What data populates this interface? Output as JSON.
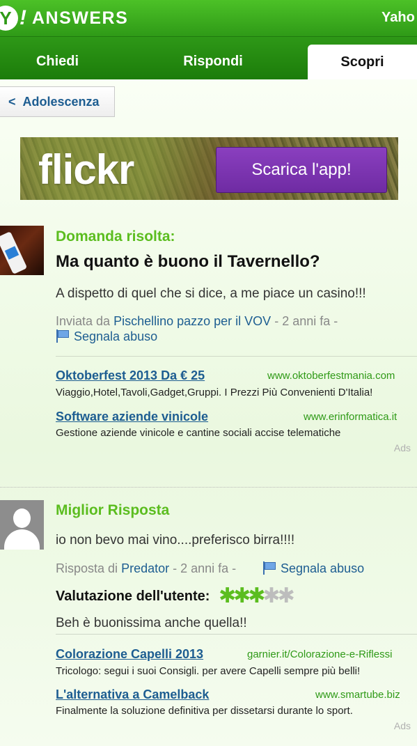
{
  "header": {
    "logo_mark": "Y",
    "logo_bang": "!",
    "logo_word": "ANSWERS",
    "yahoo_link": "Yaho"
  },
  "tabs": [
    {
      "label": "Chiedi",
      "active": false
    },
    {
      "label": "Rispondi",
      "active": false
    },
    {
      "label": "Scopri",
      "active": true
    }
  ],
  "breadcrumb": {
    "chevron": "<",
    "label": "Adolescenza"
  },
  "banner": {
    "brand": "flickr",
    "cta": "Scarica l'app!"
  },
  "question": {
    "status_label": "Domanda risolta:",
    "title": "Ma quanto è buono il Tavernello?",
    "details": "A dispetto di quel che si dice, a me piace un casino!!!",
    "meta_prefix": "Inviata da",
    "author": "Pischellino pazzo per il VOV",
    "time": "- 2 anni fa -",
    "report": "Segnala abuso"
  },
  "ads_block_1": {
    "items": [
      {
        "title": "Oktoberfest 2013 Da € 25",
        "url": "www.oktoberfestmania.com",
        "desc": "Viaggio,Hotel,Tavoli,Gadget,Gruppi. I Prezzi Più Convenienti D'Italia!"
      },
      {
        "title": "Software aziende vinicole",
        "url": "www.erinformatica.it",
        "desc": "Gestione aziende vinicole e cantine sociali accise telematiche"
      }
    ],
    "label": "Ads"
  },
  "best_answer": {
    "label": "Miglior Risposta",
    "text": "io non bevo mai vino....preferisco birra!!!!",
    "meta_prefix": "Risposta di",
    "author": "Predator",
    "time": "- 2 anni fa -",
    "report": "Segnala abuso",
    "rating_label": "Valutazione dell'utente:",
    "rating": 3,
    "rating_max": 5,
    "comment": "Beh è buonissima anche quella!!"
  },
  "ads_block_2": {
    "items": [
      {
        "title": "Colorazione Capelli 2013",
        "url": "garnier.it/Colorazione-e-Riflessi",
        "desc": "Tricologo: segui i suoi Consigli. per avere Capelli sempre più belli!"
      },
      {
        "title": "L'alternativa a Camelback",
        "url": "www.smartube.biz",
        "desc": "Finalmente la soluzione definitiva per dissetarsi durante lo sport."
      }
    ],
    "label": "Ads"
  },
  "colors": {
    "brand_green": "#2f9a17",
    "label_green": "#5bbd1f",
    "link_blue": "#1d5d91",
    "cta_purple": "#7a33ad"
  }
}
